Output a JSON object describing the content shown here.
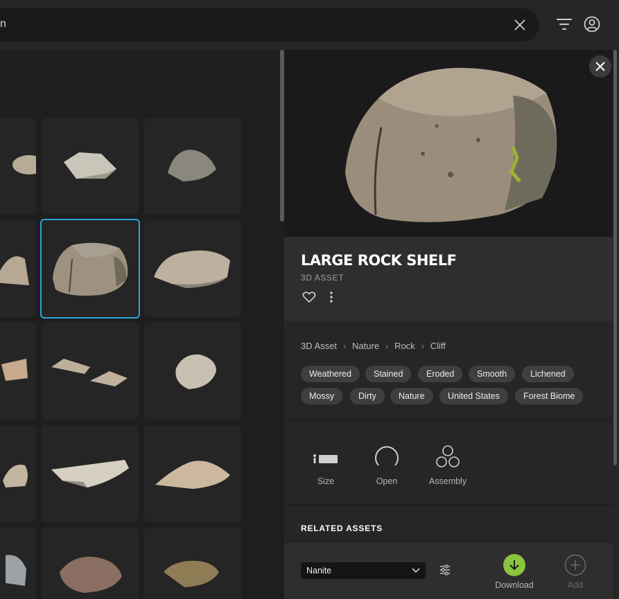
{
  "search": {
    "value": "n"
  },
  "topbar": {
    "filter_icon": "filter-icon",
    "account_icon": "user-icon"
  },
  "grid": {
    "tiles": [
      {
        "row": 1,
        "col": 0,
        "name": "rock-thumb"
      },
      {
        "row": 1,
        "col": 1,
        "name": "rock-thumb"
      },
      {
        "row": 1,
        "col": 2,
        "name": "rock-thumb"
      },
      {
        "row": 2,
        "col": 0,
        "name": "rock-thumb"
      },
      {
        "row": 2,
        "col": 1,
        "name": "rock-thumb",
        "selected": true
      },
      {
        "row": 2,
        "col": 2,
        "name": "rock-thumb"
      }
    ]
  },
  "detail": {
    "title": "LARGE ROCK SHELF",
    "type": "3D ASSET",
    "breadcrumb": [
      "3D Asset",
      "Nature",
      "Rock",
      "Cliff"
    ],
    "tags": [
      "Weathered",
      "Stained",
      "Eroded",
      "Smooth",
      "Lichened",
      "Mossy",
      "Dirty",
      "Nature",
      "United States",
      "Forest Biome"
    ],
    "actions": {
      "size": "Size",
      "open": "Open",
      "assembly": "Assembly"
    },
    "related_title": "RELATED ASSETS",
    "quality_select": "Nanite",
    "download_label": "Download",
    "add_label": "Add"
  },
  "colors": {
    "accent_blue": "#2ba3db",
    "download_green": "#8bc53f",
    "panel": "#262626",
    "background": "#1e1e1e"
  }
}
